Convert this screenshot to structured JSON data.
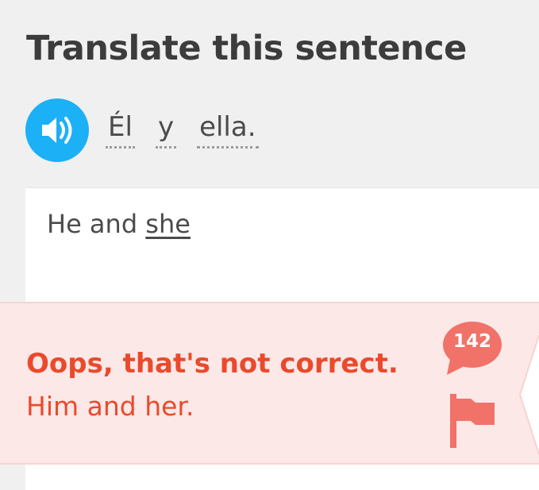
{
  "header": {
    "title": "Translate this sentence"
  },
  "prompt": {
    "speaker_icon": "speaker-icon",
    "words": [
      "Él",
      "y",
      "ella."
    ]
  },
  "answer": {
    "text_correct_part": "He and ",
    "text_error_part": "she"
  },
  "feedback": {
    "title": "Oops, that's not correct.",
    "correct_solution": "Him and her.",
    "comment_count": "142",
    "accent_color": "#ea4a2c",
    "background_color": "#fce8e7",
    "flag_color": "#f07268"
  }
}
